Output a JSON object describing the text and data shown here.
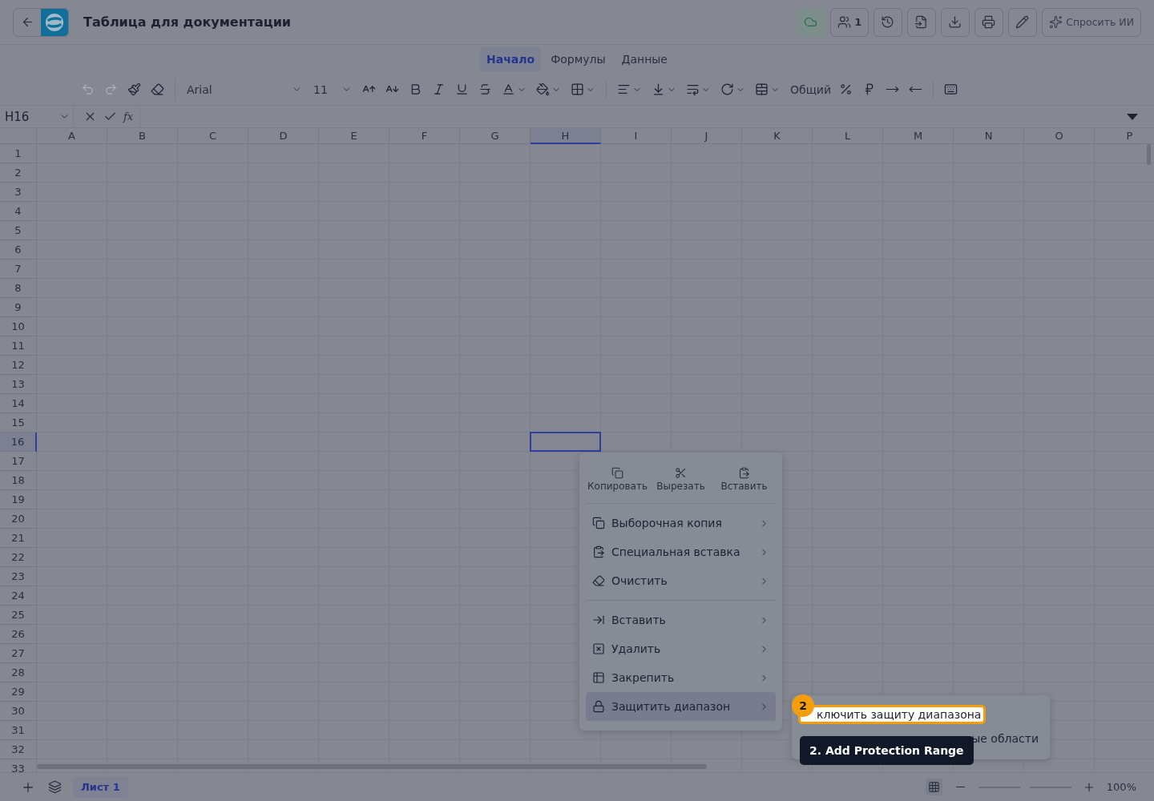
{
  "header": {
    "title": "Таблица для документации",
    "actions": [
      {
        "kind": "cloud"
      },
      {
        "kind": "users",
        "label": "1"
      },
      {
        "kind": "history"
      },
      {
        "kind": "import"
      },
      {
        "kind": "download"
      },
      {
        "kind": "print"
      },
      {
        "kind": "edit"
      },
      {
        "kind": "ai",
        "label": "Спросить ИИ"
      }
    ]
  },
  "tabs": [
    {
      "label": "Начало",
      "selected": true
    },
    {
      "label": "Формулы",
      "selected": false
    },
    {
      "label": "Данные",
      "selected": false
    }
  ],
  "toolbar": [
    {
      "kind": "button",
      "disabled": true
    },
    {
      "kind": "button",
      "disabled": true
    },
    {
      "kind": "button",
      "disabled": false
    },
    {
      "kind": "button",
      "disabled": false
    },
    {
      "kind": "separator"
    },
    {
      "kind": "select",
      "value": "Arial"
    },
    {
      "kind": "select",
      "value": "11"
    },
    {
      "kind": "button",
      "disabled": false
    },
    {
      "kind": "button",
      "disabled": false
    },
    {
      "kind": "button",
      "disabled": false
    },
    {
      "kind": "button",
      "disabled": false
    },
    {
      "kind": "button",
      "disabled": false
    },
    {
      "kind": "button",
      "disabled": false
    },
    {
      "kind": "dropdown",
      "disabled": false
    },
    {
      "kind": "dropdown",
      "disabled": false
    },
    {
      "kind": "dropdown",
      "disabled": false
    },
    {
      "kind": "separator"
    },
    {
      "kind": "dropdown",
      "disabled": false
    },
    {
      "kind": "dropdown",
      "disabled": false
    },
    {
      "kind": "dropdown",
      "disabled": false
    },
    {
      "kind": "dropdown",
      "disabled": false
    },
    {
      "kind": "dropdown",
      "disabled": false
    },
    {
      "kind": "select",
      "value": "Общий"
    },
    {
      "kind": "button",
      "disabled": false
    },
    {
      "kind": "button",
      "disabled": false
    },
    {
      "kind": "button",
      "disabled": false
    },
    {
      "kind": "button",
      "disabled": false
    },
    {
      "kind": "separator"
    },
    {
      "kind": "button",
      "disabled": false
    }
  ],
  "formula_bar": {
    "cell": "H16",
    "fx": "fx"
  },
  "columns": [
    {
      "label": "A",
      "selected": false
    },
    {
      "label": "B",
      "selected": false
    },
    {
      "label": "C",
      "selected": false
    },
    {
      "label": "D",
      "selected": false
    },
    {
      "label": "E",
      "selected": false
    },
    {
      "label": "F",
      "selected": false
    },
    {
      "label": "G",
      "selected": false
    },
    {
      "label": "H",
      "selected": true
    },
    {
      "label": "I",
      "selected": false
    },
    {
      "label": "J",
      "selected": false
    },
    {
      "label": "K",
      "selected": false
    },
    {
      "label": "L",
      "selected": false
    },
    {
      "label": "M",
      "selected": false
    },
    {
      "label": "N",
      "selected": false
    },
    {
      "label": "O",
      "selected": false
    },
    {
      "label": "P",
      "selected": false
    }
  ],
  "rows": [
    {
      "label": "1",
      "selected": false
    },
    {
      "label": "2",
      "selected": false
    },
    {
      "label": "3",
      "selected": false
    },
    {
      "label": "4",
      "selected": false
    },
    {
      "label": "5",
      "selected": false
    },
    {
      "label": "6",
      "selected": false
    },
    {
      "label": "7",
      "selected": false
    },
    {
      "label": "8",
      "selected": false
    },
    {
      "label": "9",
      "selected": false
    },
    {
      "label": "10",
      "selected": false
    },
    {
      "label": "11",
      "selected": false
    },
    {
      "label": "12",
      "selected": false
    },
    {
      "label": "13",
      "selected": false
    },
    {
      "label": "14",
      "selected": false
    },
    {
      "label": "15",
      "selected": false
    },
    {
      "label": "16",
      "selected": true
    },
    {
      "label": "17",
      "selected": false
    },
    {
      "label": "18",
      "selected": false
    },
    {
      "label": "19",
      "selected": false
    },
    {
      "label": "20",
      "selected": false
    },
    {
      "label": "21",
      "selected": false
    },
    {
      "label": "22",
      "selected": false
    },
    {
      "label": "23",
      "selected": false
    },
    {
      "label": "24",
      "selected": false
    },
    {
      "label": "25",
      "selected": false
    },
    {
      "label": "26",
      "selected": false
    },
    {
      "label": "27",
      "selected": false
    },
    {
      "label": "28",
      "selected": false
    },
    {
      "label": "29",
      "selected": false
    },
    {
      "label": "30",
      "selected": false
    },
    {
      "label": "31",
      "selected": false
    },
    {
      "label": "32",
      "selected": false
    },
    {
      "label": "33",
      "selected": false
    }
  ],
  "context_menu": {
    "quick": [
      {
        "label": "Копировать"
      },
      {
        "label": "Вырезать"
      },
      {
        "label": "Вставить"
      }
    ],
    "sections": [
      [
        {
          "label": "Выборочная копия",
          "active": false
        },
        {
          "label": "Специальная вставка",
          "active": false
        },
        {
          "label": "Очистить",
          "active": false
        }
      ],
      [
        {
          "label": "Вставить",
          "active": false
        },
        {
          "label": "Удалить",
          "active": false
        },
        {
          "label": "Закрепить",
          "active": false
        },
        {
          "label": "Защитить диапазон",
          "active": true
        }
      ]
    ]
  },
  "submenu": {
    "items": [
      {
        "label": "ключить защиту диапазона",
        "highlighted": true
      },
      {
        "label": "ые области",
        "highlighted": false
      }
    ]
  },
  "step_badge": "2",
  "tooltip": "2. Add Protection Range",
  "footer": {
    "sheets": [
      {
        "label": "Лист 1",
        "selected": true
      }
    ],
    "zoom": {
      "level": 0.5,
      "text": "100%"
    }
  }
}
